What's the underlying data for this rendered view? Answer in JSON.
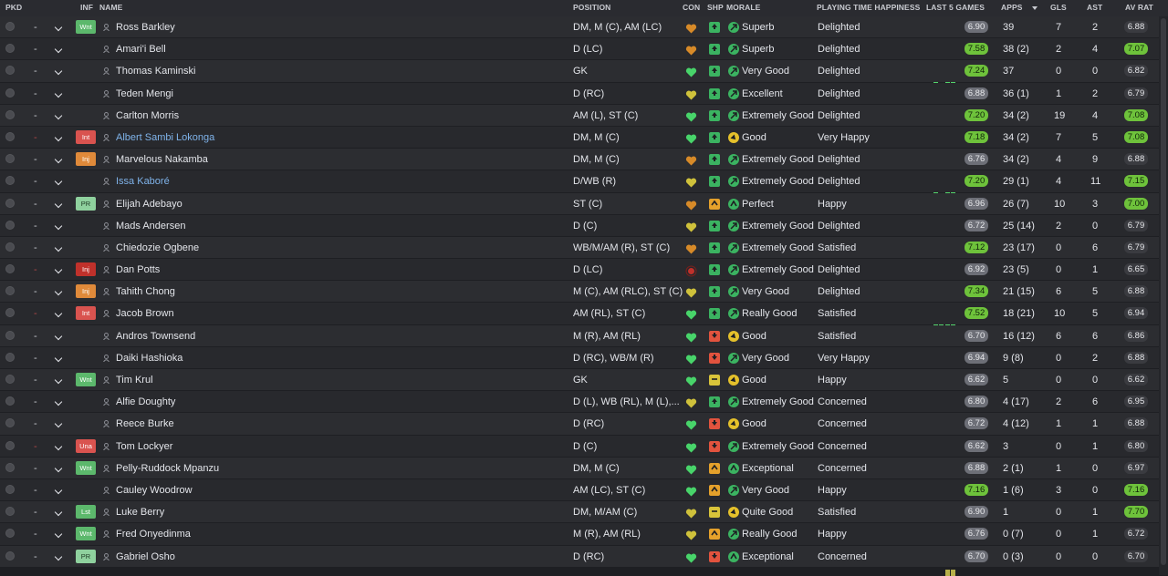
{
  "headers": {
    "pkd": "PKD",
    "inf": "INF",
    "name": "NAME",
    "position": "POSITION",
    "con": "CON",
    "shp": "SHP",
    "morale": "MORALE",
    "pth": "PLAYING TIME HAPPINESS",
    "last5": "LAST 5 GAMES",
    "apps": "APPS",
    "gls": "GLS",
    "ast": "AST",
    "avrat": "AV RAT"
  },
  "colors": {
    "good": "#6ec23b",
    "neutral": "#6d6f77",
    "heart_green": "#48d46a",
    "heart_yellow": "#cfc13b",
    "heart_orange": "#d78a28",
    "shp_green": "#3bb361",
    "shp_orange": "#e5a12b",
    "shp_yellow": "#d9c43a",
    "shp_red": "#e2533e",
    "mor_green": "#3bb361",
    "mor_yellow": "#e5c12b",
    "badge_wnt": "#5cb86c",
    "badge_int": "#d9534f",
    "badge_inj": "#e08a3a",
    "badge_injdark": "#c0312b",
    "badge_pr": "#8fd19e",
    "badge_una": "#d9534f",
    "badge_lst": "#5cb86c"
  },
  "players": [
    {
      "pkd": "-",
      "inf": "Wnt",
      "name": "Ross Barkley",
      "position": "DM, M (C), AM (LC)",
      "con": "orange",
      "shp": "up",
      "morale": "Superb",
      "pth": "Delighted",
      "bars": [
        "g",
        "y",
        "g",
        "y",
        "g"
      ],
      "last5": "6.90",
      "apps": "39",
      "gls": "7",
      "ast": "2",
      "avrat": "6.88"
    },
    {
      "pkd": "-",
      "inf": "",
      "name": "Amari'i Bell",
      "position": "D (LC)",
      "con": "orange",
      "shp": "up",
      "morale": "Superb",
      "pth": "Delighted",
      "bars": [
        "g",
        "G",
        "g",
        "G",
        "G"
      ],
      "last5": "7.58",
      "apps": "38 (2)",
      "gls": "2",
      "ast": "4",
      "avrat": "7.07"
    },
    {
      "pkd": "-",
      "inf": "",
      "name": "Thomas Kaminski",
      "position": "GK",
      "con": "green",
      "shp": "up",
      "morale": "Very Good",
      "pth": "Delighted",
      "bars": [
        "g",
        "G",
        "g",
        "G",
        "G"
      ],
      "last5": "7.24",
      "apps": "37",
      "gls": "0",
      "ast": "0",
      "avrat": "6.82"
    },
    {
      "pkd": "-",
      "inf": "",
      "name": "Teden Mengi",
      "position": "D (RC)",
      "con": "yellow",
      "shp": "up",
      "morale": "Excellent",
      "pth": "Delighted",
      "bars": [
        "g",
        "g",
        "y",
        "y",
        "y"
      ],
      "last5": "6.88",
      "apps": "36 (1)",
      "gls": "1",
      "ast": "2",
      "avrat": "6.79"
    },
    {
      "pkd": "-",
      "inf": "",
      "name": "Carlton Morris",
      "position": "AM (L), ST (C)",
      "con": "green",
      "shp": "up",
      "morale": "Extremely Good",
      "pth": "Delighted",
      "bars": [
        "g",
        "G",
        "g",
        "G",
        "G"
      ],
      "last5": "7.20",
      "apps": "34 (2)",
      "gls": "19",
      "ast": "4",
      "avrat": "7.08"
    },
    {
      "pkd": "red",
      "inf": "Int",
      "name": "Albert Sambi Lokonga",
      "position": "DM, M (C)",
      "con": "green",
      "shp": "up",
      "morale": "Good",
      "pth": "Very Happy",
      "bars": [
        "g",
        "G",
        "g",
        "G",
        "G"
      ],
      "last5": "7.18",
      "apps": "34 (2)",
      "gls": "7",
      "ast": "5",
      "avrat": "7.08",
      "blue": true
    },
    {
      "pkd": "-",
      "inf": "Inj",
      "name": "Marvelous Nakamba",
      "position": "DM, M (C)",
      "con": "orange",
      "shp": "up",
      "morale": "Extremely Good",
      "pth": "Delighted",
      "bars": [
        "g",
        "y",
        "g",
        "y",
        "y"
      ],
      "last5": "6.76",
      "apps": "34 (2)",
      "gls": "4",
      "ast": "9",
      "avrat": "6.88"
    },
    {
      "pkd": "-",
      "inf": "",
      "name": "Issa Kaboré",
      "position": "D/WB (R)",
      "con": "yellow",
      "shp": "up",
      "morale": "Extremely Good",
      "pth": "Delighted",
      "bars": [
        "g",
        "G",
        "g",
        "G",
        "G"
      ],
      "last5": "7.20",
      "apps": "29 (1)",
      "gls": "4",
      "ast": "11",
      "avrat": "7.15",
      "blue": true
    },
    {
      "pkd": "-",
      "inf": "PR",
      "name": "Elijah Adebayo",
      "position": "ST (C)",
      "con": "orange",
      "shp": "caret",
      "morale": "Perfect",
      "pth": "Happy",
      "bars": [
        "g",
        "g",
        "y",
        "y",
        "y"
      ],
      "last5": "6.96",
      "apps": "26 (7)",
      "gls": "10",
      "ast": "3",
      "avrat": "7.00"
    },
    {
      "pkd": "-",
      "inf": "",
      "name": "Mads Andersen",
      "position": "D (C)",
      "con": "yellow",
      "shp": "up",
      "morale": "Extremely Good",
      "pth": "Delighted",
      "bars": [
        "g",
        "y",
        "g",
        "y",
        "y"
      ],
      "last5": "6.72",
      "apps": "25 (14)",
      "gls": "2",
      "ast": "0",
      "avrat": "6.79"
    },
    {
      "pkd": "-",
      "inf": "",
      "name": "Chiedozie Ogbene",
      "position": "WB/M/AM (R), ST (C)",
      "con": "orange",
      "shp": "up",
      "morale": "Extremely Good",
      "pth": "Satisfied",
      "bars": [
        "g",
        "y",
        "g",
        "G",
        "y"
      ],
      "last5": "7.12",
      "apps": "23 (17)",
      "gls": "0",
      "ast": "6",
      "avrat": "6.79"
    },
    {
      "pkd": "red",
      "inf": "Inj2",
      "name": "Dan Potts",
      "position": "D (LC)",
      "con": "red",
      "shp": "up",
      "morale": "Extremely Good",
      "pth": "Delighted",
      "bars": [
        "g",
        "g",
        "y",
        "y",
        "y"
      ],
      "last5": "6.92",
      "apps": "23 (5)",
      "gls": "0",
      "ast": "1",
      "avrat": "6.65"
    },
    {
      "pkd": "-",
      "inf": "Inj",
      "name": "Tahith Chong",
      "position": "M (C), AM (RLC), ST (C)",
      "con": "yellow",
      "shp": "up",
      "morale": "Very Good",
      "pth": "Delighted",
      "bars": [
        "g",
        "y",
        "g",
        "G",
        "G"
      ],
      "last5": "7.34",
      "apps": "21 (15)",
      "gls": "6",
      "ast": "5",
      "avrat": "6.88"
    },
    {
      "pkd": "red",
      "inf": "Int",
      "name": "Jacob Brown",
      "position": "AM (RL), ST (C)",
      "con": "green",
      "shp": "up",
      "morale": "Really Good",
      "pth": "Satisfied",
      "bars": [
        "g",
        "G",
        "G",
        "G",
        "G"
      ],
      "last5": "7.52",
      "apps": "18 (21)",
      "gls": "10",
      "ast": "5",
      "avrat": "6.94"
    },
    {
      "pkd": "-",
      "inf": "",
      "name": "Andros Townsend",
      "position": "M (R), AM (RL)",
      "con": "green",
      "shp": "down",
      "morale": "Good",
      "pth": "Satisfied",
      "bars": [
        "o",
        "y",
        "g",
        "y",
        "y"
      ],
      "last5": "6.70",
      "apps": "16 (12)",
      "gls": "6",
      "ast": "6",
      "avrat": "6.86"
    },
    {
      "pkd": "-",
      "inf": "",
      "name": "Daiki Hashioka",
      "position": "D (RC), WB/M (R)",
      "con": "green",
      "shp": "down",
      "morale": "Very Good",
      "pth": "Very Happy",
      "bars": [
        "o",
        "y",
        "g",
        "y",
        "y"
      ],
      "last5": "6.94",
      "apps": "9 (8)",
      "gls": "0",
      "ast": "2",
      "avrat": "6.88"
    },
    {
      "pkd": "-",
      "inf": "Wnt",
      "name": "Tim Krul",
      "position": "GK",
      "con": "green",
      "shp": "dash",
      "morale": "Good",
      "pth": "Happy",
      "bars": [
        "o",
        "y",
        "g",
        "y",
        "y"
      ],
      "last5": "6.62",
      "apps": "5",
      "gls": "0",
      "ast": "0",
      "avrat": "6.62"
    },
    {
      "pkd": "-",
      "inf": "",
      "name": "Alfie Doughty",
      "position": "D (L), WB (RL), M (L),...",
      "con": "yellow",
      "shp": "up",
      "morale": "Extremely Good",
      "pth": "Concerned",
      "bars": [
        "o",
        "y",
        "g",
        "y",
        "y"
      ],
      "last5": "6.80",
      "apps": "4 (17)",
      "gls": "2",
      "ast": "6",
      "avrat": "6.95"
    },
    {
      "pkd": "-",
      "inf": "",
      "name": "Reece Burke",
      "position": "D (RC)",
      "con": "green",
      "shp": "down",
      "morale": "Good",
      "pth": "Concerned",
      "bars": [
        "o",
        "y",
        "g",
        "y",
        "y"
      ],
      "last5": "6.72",
      "apps": "4 (12)",
      "gls": "1",
      "ast": "1",
      "avrat": "6.88"
    },
    {
      "pkd": "red",
      "inf": "Una",
      "name": "Tom Lockyer",
      "position": "D (C)",
      "con": "green",
      "shp": "down",
      "morale": "Extremely Good",
      "pth": "Concerned",
      "bars": [
        "o",
        "y",
        "g",
        "y",
        "y"
      ],
      "last5": "6.62",
      "apps": "3",
      "gls": "0",
      "ast": "1",
      "avrat": "6.80"
    },
    {
      "pkd": "-",
      "inf": "Wnt",
      "name": "Pelly-Ruddock Mpanzu",
      "position": "DM, M (C)",
      "con": "green",
      "shp": "caret",
      "morale": "Exceptional",
      "pth": "Concerned",
      "bars": [
        "o",
        "y",
        "g",
        "y",
        "y"
      ],
      "last5": "6.88",
      "apps": "2 (1)",
      "gls": "1",
      "ast": "0",
      "avrat": "6.97"
    },
    {
      "pkd": "-",
      "inf": "",
      "name": "Cauley Woodrow",
      "position": "AM (LC), ST (C)",
      "con": "green",
      "shp": "caret",
      "morale": "Very Good",
      "pth": "Happy",
      "bars": [
        "g",
        "G",
        "g",
        "G",
        "G"
      ],
      "last5": "7.16",
      "apps": "1 (6)",
      "gls": "3",
      "ast": "0",
      "avrat": "7.16"
    },
    {
      "pkd": "-",
      "inf": "Lst",
      "name": "Luke Berry",
      "position": "DM, M/AM (C)",
      "con": "yellow",
      "shp": "dash",
      "morale": "Quite Good",
      "pth": "Satisfied",
      "bars": [
        "",
        "",
        "y",
        "y",
        "y"
      ],
      "last5": "6.90",
      "apps": "1",
      "gls": "0",
      "ast": "1",
      "avrat": "7.70"
    },
    {
      "pkd": "-",
      "inf": "Wnt",
      "name": "Fred Onyedinma",
      "position": "M (R), AM (RL)",
      "con": "yellow",
      "shp": "caret",
      "morale": "Really Good",
      "pth": "Happy",
      "bars": [
        "",
        "",
        "y",
        "y",
        "y"
      ],
      "last5": "6.76",
      "apps": "0 (7)",
      "gls": "0",
      "ast": "1",
      "avrat": "6.72"
    },
    {
      "pkd": "-",
      "inf": "PR",
      "name": "Gabriel Osho",
      "position": "D (RC)",
      "con": "green",
      "shp": "down",
      "morale": "Exceptional",
      "pth": "Concerned",
      "bars": [
        "",
        "",
        "",
        "y",
        "y"
      ],
      "last5": "6.70",
      "apps": "0 (3)",
      "gls": "0",
      "ast": "0",
      "avrat": "6.70"
    }
  ],
  "moraleGreen": [
    "Superb",
    "Very Good",
    "Excellent",
    "Extremely Good",
    "Really Good",
    "Perfect",
    "Exceptional"
  ],
  "moraleYellow": [
    "Good",
    "Quite Good"
  ]
}
